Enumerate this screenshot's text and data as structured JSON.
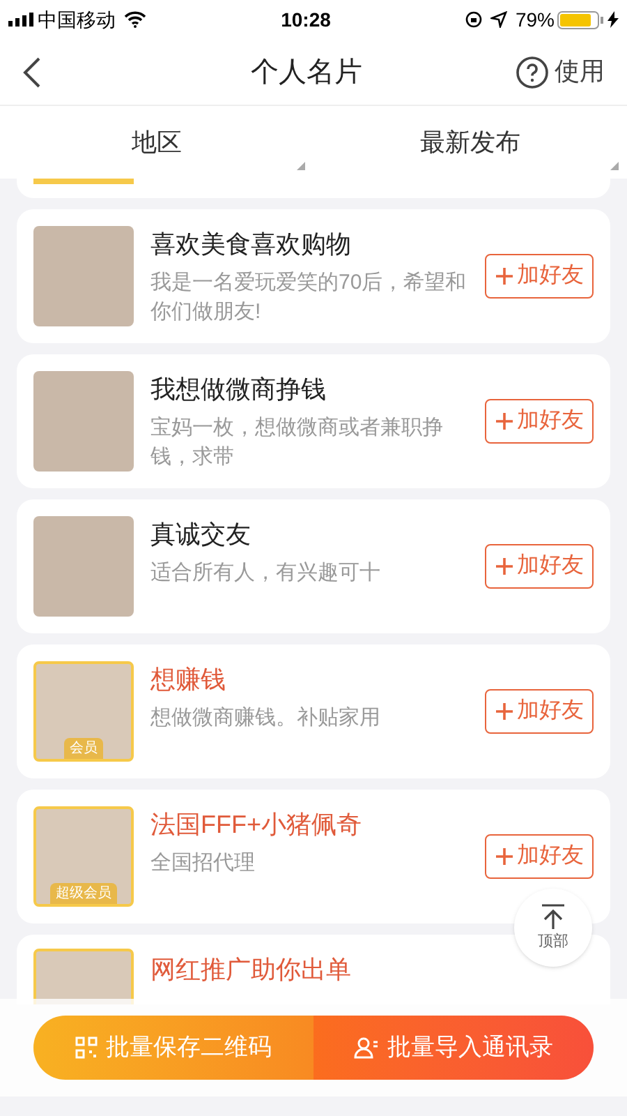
{
  "status_bar": {
    "carrier": "中国移动",
    "time": "10:28",
    "battery": "79%"
  },
  "nav": {
    "title": "个人名片",
    "help": "使用"
  },
  "tabs": [
    {
      "label": "地区"
    },
    {
      "label": "最新发布"
    }
  ],
  "cards": [
    {
      "name": "喜欢美食喜欢购物",
      "desc": "我是一名爱玩爱笑的70后，希望和你们做朋友!",
      "vip": false,
      "button": "加好友"
    },
    {
      "name": "我想做微商挣钱",
      "desc": "宝妈一枚，想做微商或者兼职挣钱，求带",
      "vip": false,
      "button": "加好友"
    },
    {
      "name": "真诚交友",
      "desc": "适合所有人，有兴趣可十",
      "vip": false,
      "button": "加好友"
    },
    {
      "name": "想赚钱",
      "desc": "想做微商赚钱。补贴家用",
      "vip": true,
      "badge": "会员",
      "button": "加好友"
    },
    {
      "name": "法国FFF+小猪佩奇",
      "desc": "全国招代理",
      "vip": true,
      "badge": "超级会员",
      "button": "加好友"
    },
    {
      "name": "网红推广助你出单",
      "vip": true
    }
  ],
  "top_button": {
    "label": "顶部"
  },
  "bottom_actions": [
    {
      "label": "批量保存二维码",
      "kind": "qr"
    },
    {
      "label": "批量导入通讯录",
      "kind": "contacts"
    }
  ]
}
